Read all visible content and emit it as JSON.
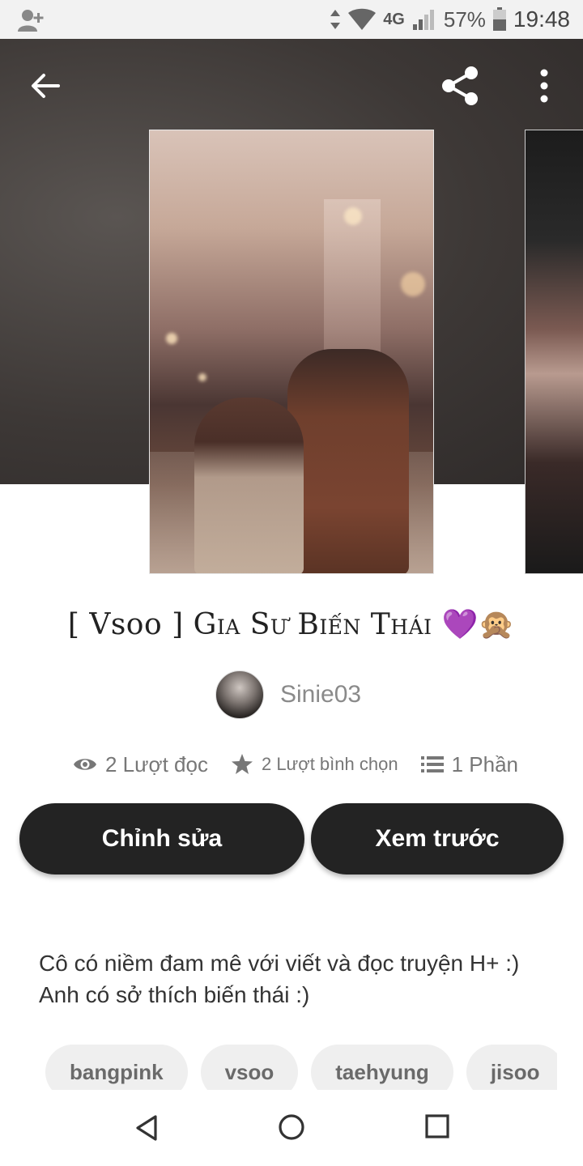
{
  "status_bar": {
    "network": "4G",
    "battery": "57%",
    "time": "19:48",
    "icons": [
      "add-user-icon",
      "data-arrows-icon",
      "wifi-icon",
      "signal-icon",
      "battery-icon"
    ]
  },
  "header": {
    "icons": [
      "back-arrow-icon",
      "share-icon",
      "more-vert-icon"
    ]
  },
  "story": {
    "title_part1": "[ Vsoo ] ",
    "title_part2": "Gia Sư Biến Thái",
    "title_emoji": "💜🙊",
    "author": "Sinie03",
    "stats": {
      "reads": "2 Lượt đọc",
      "votes": "2 Lượt bình chọn",
      "parts": "1 Phần"
    },
    "description_line1": "Cô có niềm đam mê với viết và đọc truyện H+ :)",
    "description_line2": "Anh có sở thích biến thái :)"
  },
  "actions": {
    "edit_label": "Chỉnh sửa",
    "preview_label": "Xem trước"
  },
  "tags": [
    "bangpink",
    "vsoo",
    "taehyung",
    "jisoo"
  ],
  "nav": {
    "icons": [
      "nav-back-icon",
      "nav-home-icon",
      "nav-recent-icon"
    ]
  },
  "colors": {
    "button_bg": "#232323",
    "tag_bg": "#efefef",
    "hero_bg": "#3d3836"
  }
}
